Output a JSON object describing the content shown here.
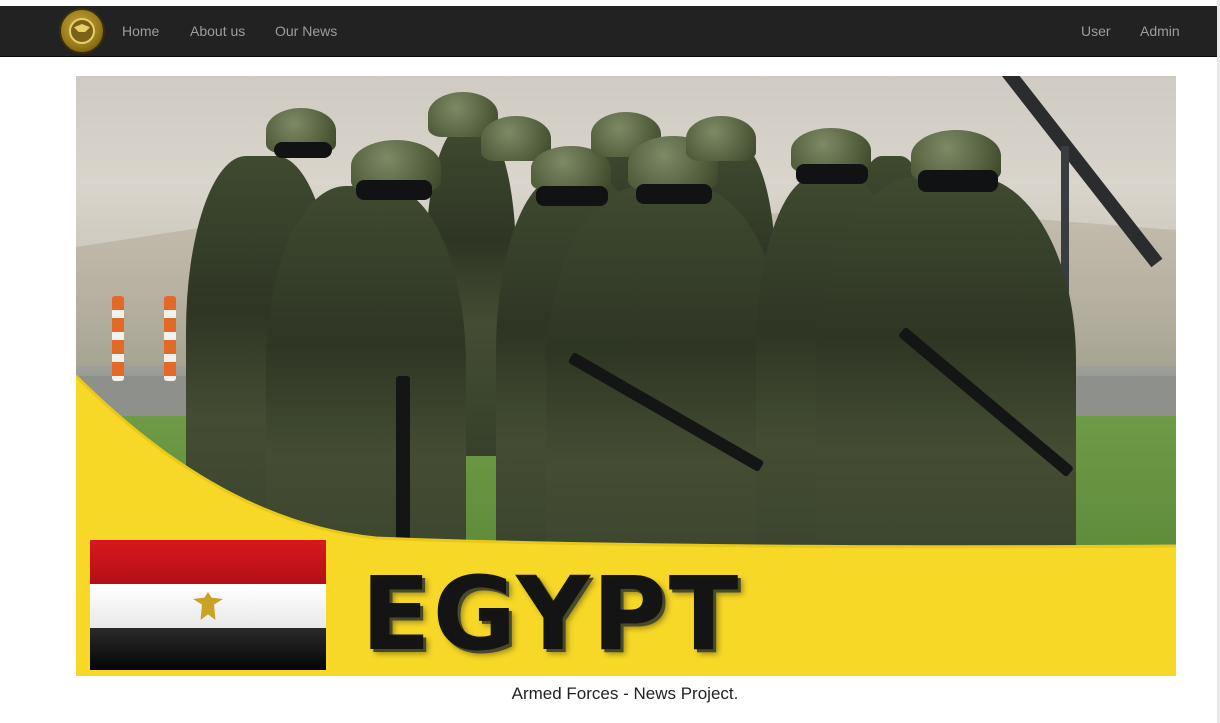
{
  "navbar": {
    "brand_icon": "armed-forces-emblem-icon",
    "links_left": [
      {
        "label": "Home"
      },
      {
        "label": "About us"
      },
      {
        "label": "Our News"
      }
    ],
    "links_right": [
      {
        "label": "User"
      },
      {
        "label": "Admin"
      }
    ],
    "background_color": "#222222",
    "link_color": "#9d9d9d"
  },
  "hero": {
    "banner_text": "EGYPT",
    "banner_color": "#f7d826",
    "flag_icon": "egypt-flag-icon"
  },
  "footer": {
    "caption": "Armed Forces - News Project."
  }
}
